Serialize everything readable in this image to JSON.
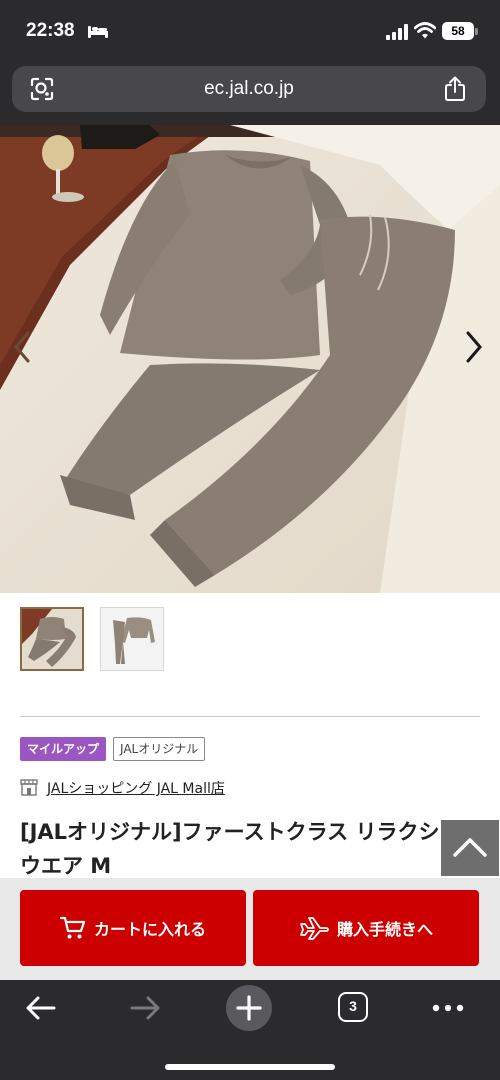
{
  "status_bar": {
    "time": "22:38",
    "battery": "58"
  },
  "browser": {
    "url": "ec.jal.co.jp",
    "tab_count": "3"
  },
  "icons": {
    "status": [
      "bed-icon",
      "signal-icon",
      "wifi-icon",
      "battery-icon"
    ],
    "url_bar": [
      "lens-icon",
      "share-icon"
    ],
    "gallery": [
      "chevron-left-icon",
      "chevron-right-icon"
    ],
    "toolbar": [
      "back-arrow-icon",
      "forward-arrow-icon",
      "plus-icon",
      "tabs-icon",
      "more-icon"
    ]
  },
  "gallery": {
    "thumbnail_count": 2,
    "selected_index": 0
  },
  "product": {
    "tags": {
      "mileup": "マイルアップ",
      "original": "JALオリジナル"
    },
    "shop_name": "JALショッピング JAL Mall店",
    "title": "[JALオリジナル]ファーストクラス リラクシングウエア M"
  },
  "actions": {
    "cart_label": "カートに入れる",
    "buy_label": "購入手続きへ"
  },
  "colors": {
    "accent_red": "#cc0000",
    "mileup_tag": "#9a57c2",
    "chrome_dark": "#2b2b2d"
  }
}
